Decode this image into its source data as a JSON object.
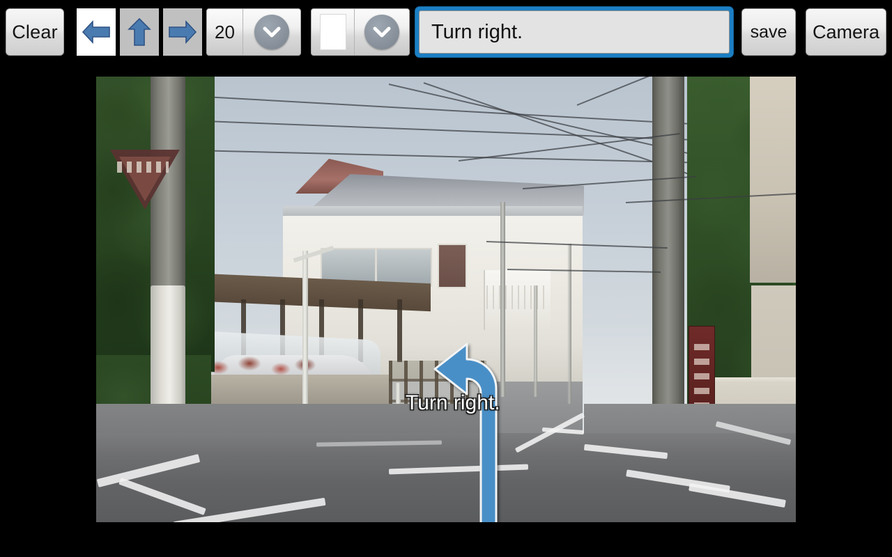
{
  "toolbar": {
    "clear_label": "Clear",
    "directions": [
      {
        "name": "arrow-left",
        "icon": "arrow-left-icon",
        "selected": true
      },
      {
        "name": "arrow-up",
        "icon": "arrow-up-icon",
        "selected": false
      },
      {
        "name": "arrow-right",
        "icon": "arrow-right-icon",
        "selected": false
      }
    ],
    "font_size": {
      "value": "20",
      "icon": "chevron-down-icon"
    },
    "color": {
      "value": "#ffffff",
      "icon": "chevron-down-icon"
    },
    "text_input": {
      "value": "Turn right.",
      "placeholder": "Enter caption"
    },
    "save_label": "save",
    "camera_label": "Camera"
  },
  "canvas": {
    "overlay_caption": "Turn right.",
    "arrow_color": "#4a8fc7",
    "arrow_outline": "#f2f4f5",
    "arrow_direction": "left"
  },
  "colors": {
    "background": "#000000",
    "focus_border": "#1c7fc4",
    "arrow_glyph": "#4a7bb0",
    "button_face": "#e0e0e0"
  }
}
